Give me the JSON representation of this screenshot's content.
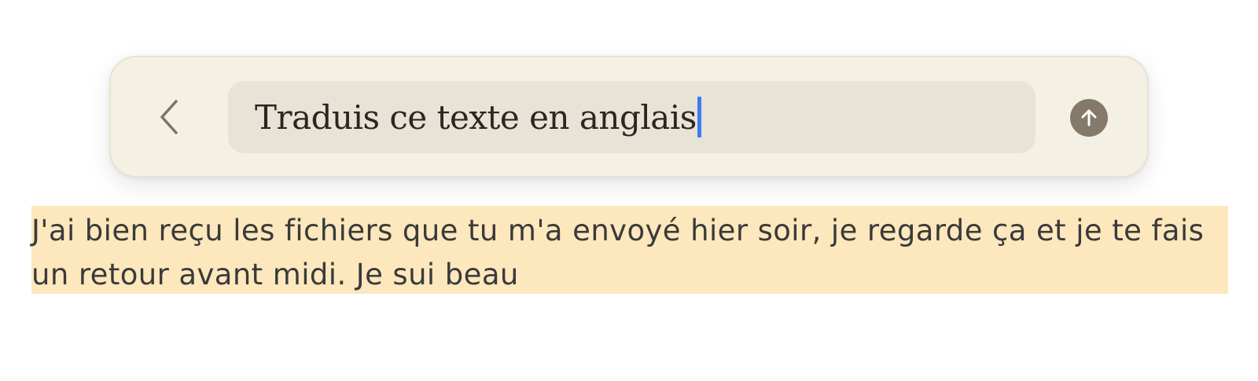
{
  "prompt_bar": {
    "input_value": "Traduis ce texte en anglais",
    "back_icon": "chevron-left-icon",
    "submit_icon": "arrow-up-icon"
  },
  "document": {
    "selected_text": "J'ai bien reçu les fichiers que tu m'a envoyé hier soir, je regarde ça et je te fais un retour avant midi. Je sui beau"
  },
  "colors": {
    "bar_background": "#f4f0e4",
    "input_background": "#e8e3d7",
    "submit_button": "#857a6a",
    "caret": "#3b7cf4",
    "selection_highlight": "#fde8bd"
  }
}
